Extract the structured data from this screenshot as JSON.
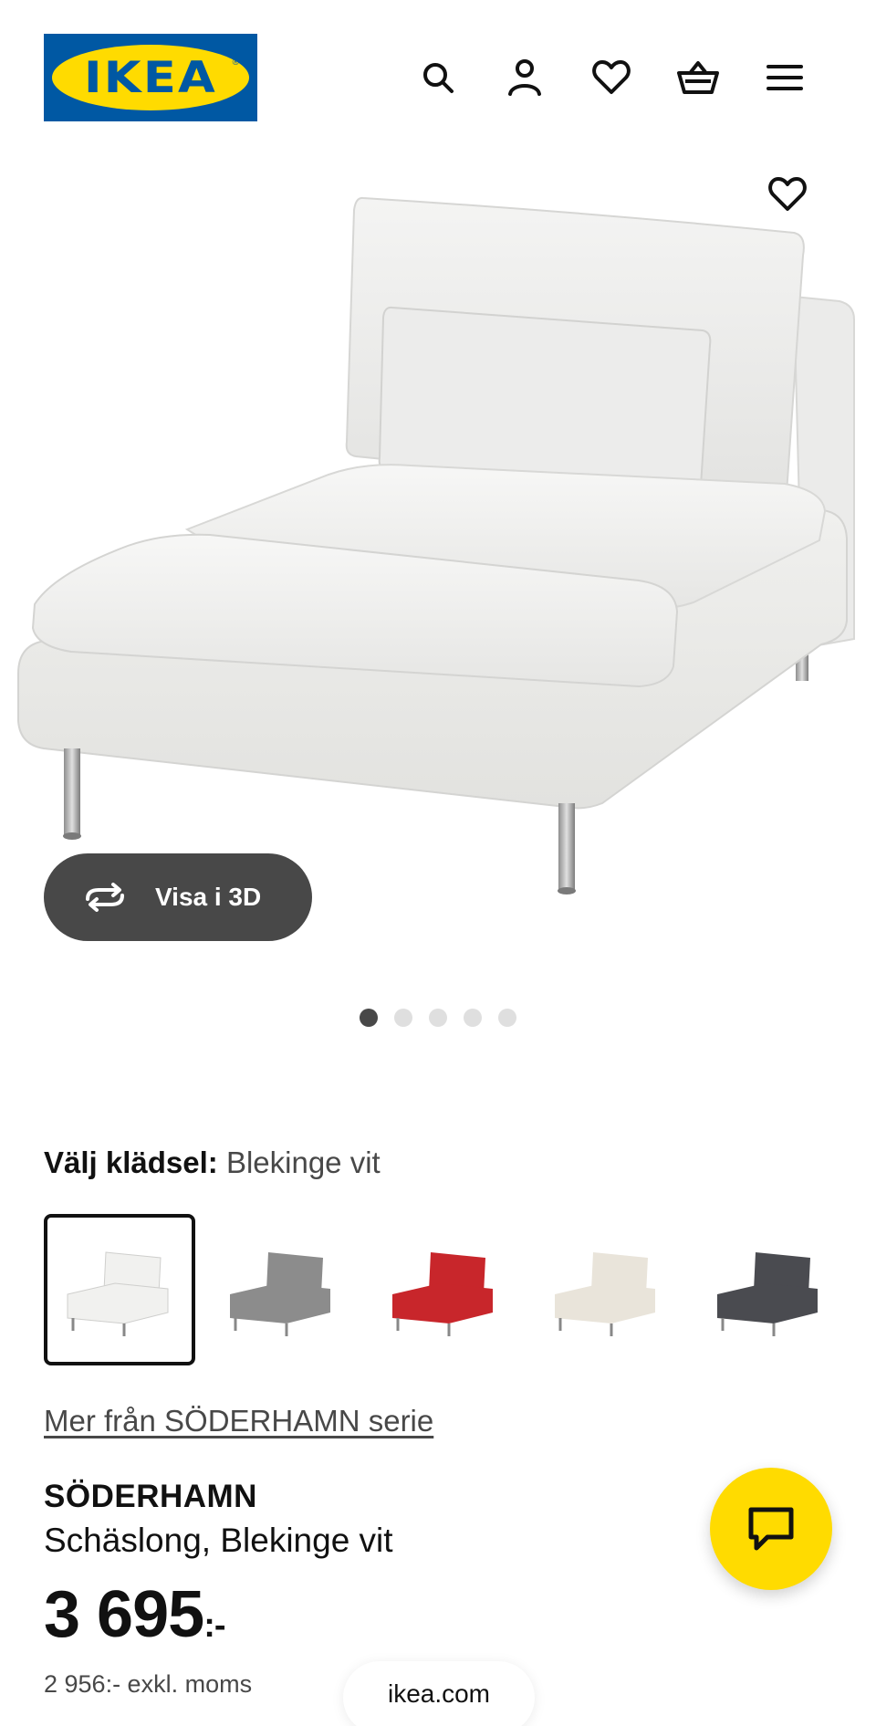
{
  "header": {
    "logo_text": "IKEA",
    "logo_reg": "®",
    "icons": [
      "search-icon",
      "account-icon",
      "heart-icon",
      "basket-icon",
      "menu-icon"
    ]
  },
  "hero": {
    "view_3d_label": "Visa i 3D",
    "image_count": 5,
    "active_index": 0
  },
  "options": {
    "label": "Välj klädsel:",
    "selected_value": "Blekinge vit",
    "swatch_colors": [
      "#f1f1ef",
      "#8c8c8c",
      "#c8262b",
      "#e9e4da",
      "#4a4b50"
    ]
  },
  "series_link": "Mer från SÖDERHAMN serie",
  "product": {
    "name": "SÖDERHAMN",
    "description": "Schäslong, Blekinge vit",
    "price": "3 695",
    "price_suffix": ":-",
    "price_ex_vat": "2 956:- exkl. moms"
  },
  "browser": {
    "url": "ikea.com"
  },
  "colors": {
    "brand_blue": "#0058a3",
    "brand_yellow": "#ffdb00",
    "dark_grey": "#484848"
  }
}
